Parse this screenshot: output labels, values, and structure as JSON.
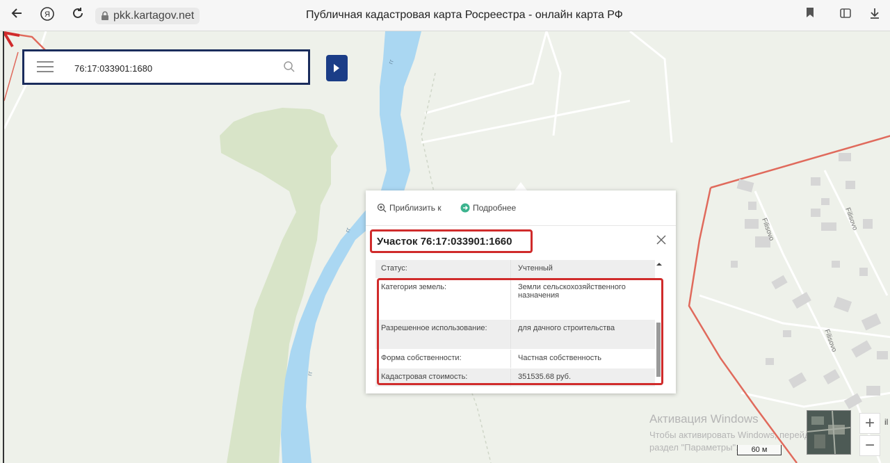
{
  "browser": {
    "url": "pkk.kartagov.net",
    "title": "Публичная кадастровая карта Росреестра - онлайн карта РФ",
    "yandex_label": "Я"
  },
  "search": {
    "value": "76:17:033901:1680"
  },
  "popup": {
    "zoom_label": "Приблизить к",
    "more_label": "Подробнее",
    "title": "Участок 76:17:033901:1660",
    "rows": [
      {
        "key": "Статус:",
        "value": "Учтенный"
      },
      {
        "key": "Категория земель:",
        "value": "Земли сельскохозяйственного назначения"
      },
      {
        "key": "Разрешенное использование:",
        "value": "для дачного строительства"
      },
      {
        "key": "Форма собственности:",
        "value": "Частная собственность"
      },
      {
        "key": "Кадастровая стоимость:",
        "value": "351535.68 руб."
      }
    ]
  },
  "map": {
    "street_labels": [
      "Filisovo",
      "Filisovo",
      "Filisovo"
    ],
    "river_labels": [
      "гг",
      "гг",
      "гг"
    ],
    "scale_label": "60 м",
    "zoom_in": "+",
    "zoom_out": "−",
    "edge_label": "il"
  },
  "watermark": {
    "line1": "Активация Windows",
    "line2": "Чтобы активировать Windows, перейдите в",
    "line3": "раздел \"Параметры\"."
  },
  "colors": {
    "river": "#aad7f2",
    "forest": "#d6e3c5",
    "boundary": "#e06a5c",
    "highlight": "#d02b2b",
    "nav_button": "#1b3d87"
  }
}
